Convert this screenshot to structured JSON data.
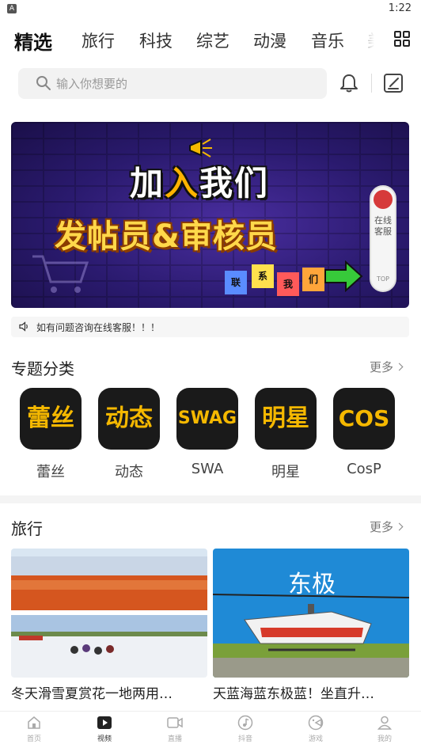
{
  "status_bar": {
    "app_badge": "A",
    "time": "1:22"
  },
  "tabs": [
    {
      "label": "精选",
      "active": true
    },
    {
      "label": "旅行",
      "active": false
    },
    {
      "label": "科技",
      "active": false
    },
    {
      "label": "综艺",
      "active": false
    },
    {
      "label": "动漫",
      "active": false
    },
    {
      "label": "音乐",
      "active": false
    },
    {
      "label": "美",
      "active": false
    }
  ],
  "search": {
    "placeholder": "输入你想要的"
  },
  "banner": {
    "line1_a": "加",
    "line1_b": "入",
    "line1_c": "我们",
    "line2": "发帖员&审核员",
    "tags": [
      "联",
      "系",
      "我",
      "们"
    ],
    "service_text": "在线客服",
    "service_top": "TOP"
  },
  "notice": {
    "text": "如有问题咨询在线客服！！！"
  },
  "categories_section": {
    "title": "专题分类",
    "more": "更多",
    "items": [
      {
        "icon_text": "蕾丝",
        "label": "蕾丝"
      },
      {
        "icon_text": "动态",
        "label": "动态"
      },
      {
        "icon_text": "SWAG",
        "label": "SWA"
      },
      {
        "icon_text": "明星",
        "label": "明星"
      },
      {
        "icon_text": "COS",
        "label": "CosP"
      }
    ]
  },
  "travel_section": {
    "title": "旅行",
    "more": "更多",
    "cards": [
      {
        "title": "冬天滑雪夏赏花一地两用…"
      },
      {
        "title": "天蓝海蓝东极蓝！坐直升…",
        "overlay": "东极"
      }
    ]
  },
  "bottom_nav": [
    {
      "label": "首页",
      "icon": "home-icon",
      "active": false
    },
    {
      "label": "视频",
      "icon": "play-icon",
      "active": true
    },
    {
      "label": "直播",
      "icon": "camera-icon",
      "active": false
    },
    {
      "label": "抖音",
      "icon": "music-note-icon",
      "active": false
    },
    {
      "label": "游戏",
      "icon": "gamepad-icon",
      "active": false
    },
    {
      "label": "我的",
      "icon": "user-icon",
      "active": false
    }
  ],
  "colors": {
    "banner_bg": "#2a1a6e",
    "accent_yellow": "#f5b800",
    "active_nav": "#333333"
  }
}
